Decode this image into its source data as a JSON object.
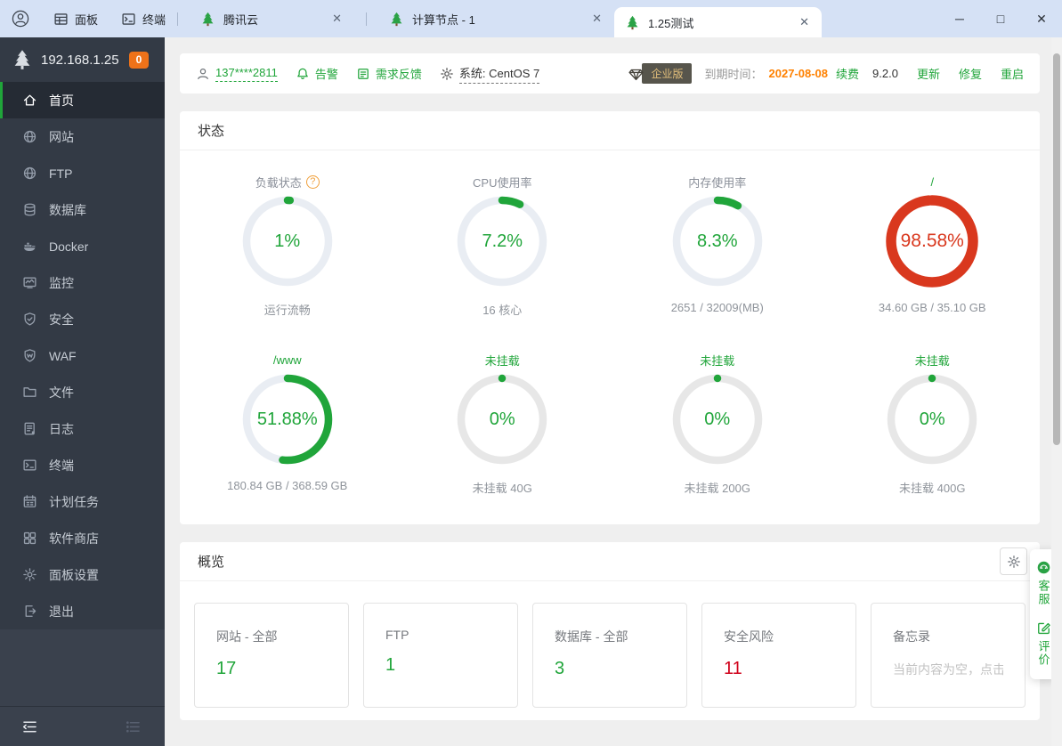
{
  "titlebar": {
    "panel_label": "面板",
    "terminal_label": "终端",
    "tabs": [
      {
        "label": "腾讯云"
      },
      {
        "label": "计算节点 - 1"
      },
      {
        "label": "1.25测试"
      }
    ]
  },
  "sidebar": {
    "server_ip": "192.168.1.25",
    "notification_count": "0",
    "items": [
      {
        "label": "首页"
      },
      {
        "label": "网站"
      },
      {
        "label": "FTP"
      },
      {
        "label": "数据库"
      },
      {
        "label": "Docker"
      },
      {
        "label": "监控"
      },
      {
        "label": "安全"
      },
      {
        "label": "WAF"
      },
      {
        "label": "文件"
      },
      {
        "label": "日志"
      },
      {
        "label": "终端"
      },
      {
        "label": "计划任务"
      },
      {
        "label": "软件商店"
      },
      {
        "label": "面板设置"
      },
      {
        "label": "退出"
      }
    ]
  },
  "topbar": {
    "username": "137****2811",
    "alarm_label": "告警",
    "feedback_label": "需求反馈",
    "system_label": "系统: CentOS 7",
    "edition_label": "企业版",
    "expire_label": "到期时间：",
    "expire_date": "2027-08-08",
    "renew_label": "续费",
    "version": "9.2.0",
    "update_label": "更新",
    "repair_label": "修复",
    "restart_label": "重启"
  },
  "status_section": {
    "title": "状态",
    "gauges": [
      {
        "title": "负载状态",
        "value": "1%",
        "percent": 1,
        "caption": "运行流畅",
        "state": "ok",
        "title_green": false,
        "help": true
      },
      {
        "title": "CPU使用率",
        "value": "7.2%",
        "percent": 7.2,
        "caption": "16 核心",
        "state": "ok",
        "title_green": false
      },
      {
        "title": "内存使用率",
        "value": "8.3%",
        "percent": 8.3,
        "caption": "2651 / 32009(MB)",
        "state": "ok",
        "title_green": false
      },
      {
        "title": "/",
        "value": "98.58%",
        "percent": 98.58,
        "caption": "34.60 GB / 35.10 GB",
        "state": "danger",
        "title_green": true
      },
      {
        "title": "/www",
        "value": "51.88%",
        "percent": 51.88,
        "caption": "180.84 GB / 368.59 GB",
        "state": "ok",
        "title_green": true
      },
      {
        "title": "未挂载",
        "value": "0%",
        "percent": 0,
        "caption": "未挂载 40G",
        "state": "unmounted",
        "title_green": true
      },
      {
        "title": "未挂载",
        "value": "0%",
        "percent": 0,
        "caption": "未挂载 200G",
        "state": "unmounted",
        "title_green": true
      },
      {
        "title": "未挂载",
        "value": "0%",
        "percent": 0,
        "caption": "未挂载 400G",
        "state": "unmounted",
        "title_green": true
      }
    ]
  },
  "overview": {
    "title": "概览",
    "cards": [
      {
        "label": "网站 - 全部",
        "value": "17",
        "color": "#20a53a"
      },
      {
        "label": "FTP",
        "value": "1",
        "color": "#20a53a"
      },
      {
        "label": "数据库 - 全部",
        "value": "3",
        "color": "#20a53a"
      },
      {
        "label": "安全风险",
        "value": "11",
        "color": "#d0021b"
      },
      {
        "label": "备忘录",
        "value": "当前内容为空，点击",
        "color": "#c2c2c2"
      }
    ]
  },
  "floating_widget": {
    "service_label": "客服",
    "review_label": "评价"
  },
  "colors": {
    "accent_green": "#20a53a",
    "danger_red": "#d9381e",
    "warning_orange": "#ff8100",
    "titlebar_bg": "#d5e1f5",
    "sidebar_bg": "#333a45",
    "badge_orange": "#ee7219"
  }
}
